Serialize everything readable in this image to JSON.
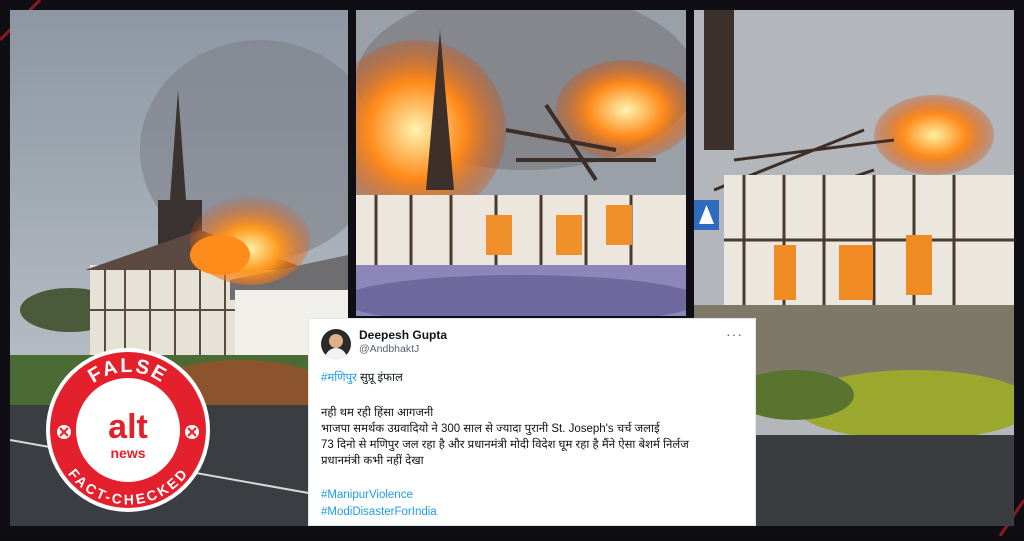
{
  "tweet": {
    "name": "Deepesh Gupta",
    "handle": "@AndbhaktJ",
    "more_icon": "more-horizontal-icon",
    "line1_tag": "#मणिपुर",
    "line1_text": " सुप्रू इंफाल",
    "line2": "नही थम रही हिंसा आगजनी",
    "line3": "भाजपा समर्थक उग्रवादियो ने 300 साल से ज्यादा पुरानी St. Joseph's चर्च जलाई",
    "line4": "73 दिनो से मणिपुर जल रहा है और प्रधानमंत्री मोदी विदेश घूम रहा है मैंने ऐसा बेशर्म निर्लज",
    "line5": "प्रधानमंत्री कभी नहीं देखा",
    "hashtag1": "#ManipurViolence",
    "hashtag2": "#ModiDisasterForIndia"
  },
  "badge": {
    "top_text": "FALSE",
    "bottom_text": "FACT-CHECKED",
    "logo_top": "alt",
    "logo_bottom": "news",
    "color": "#e3202c"
  },
  "colors": {
    "accent_red": "#e3202c",
    "link_blue": "#1d9bf0"
  }
}
